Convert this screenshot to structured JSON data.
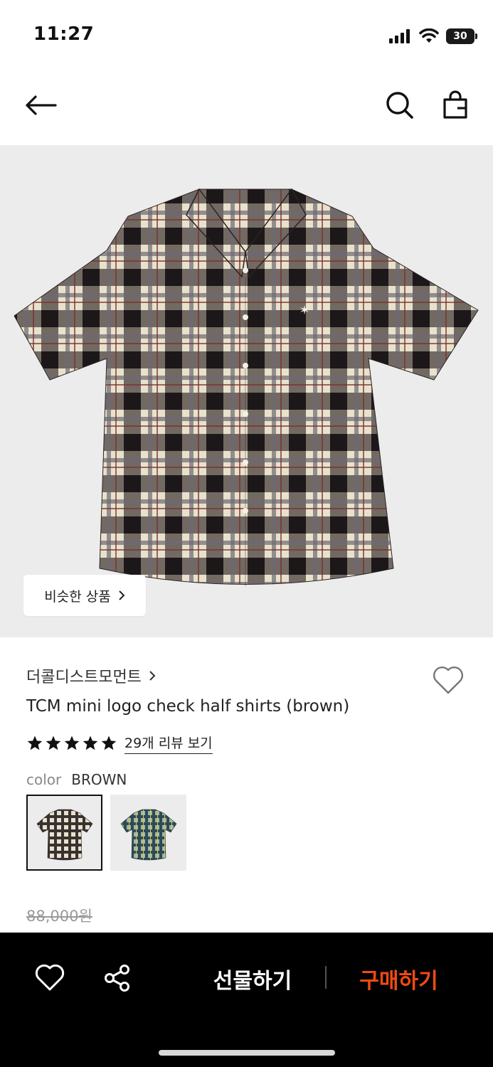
{
  "status_bar": {
    "time": "11:27",
    "battery": "30",
    "icons": [
      "signal-icon",
      "wifi-icon",
      "battery-icon"
    ]
  },
  "header": {
    "icons": [
      "back-arrow-icon",
      "search-icon",
      "shopping-bag-icon"
    ]
  },
  "hero": {
    "similar_products_label": "비슷한 상품",
    "image": "plaid-short-sleeve-shirt-brown"
  },
  "product": {
    "brand": "더콜디스트모먼트",
    "name": "TCM mini logo check half shirts (brown)",
    "rating_stars": 5,
    "review_link": "29개 리뷰 보기",
    "color_label": "color",
    "color_value": "BROWN",
    "swatches": [
      {
        "name": "brown",
        "selected": true
      },
      {
        "name": "green",
        "selected": false
      }
    ],
    "original_price": "88,000원"
  },
  "bottom_bar": {
    "gift_label": "선물하기",
    "buy_label": "구매하기",
    "buy_color": "#f04a12"
  },
  "colors": {
    "hero_bg": "#ececec",
    "bottom_bar_bg": "#000000"
  }
}
